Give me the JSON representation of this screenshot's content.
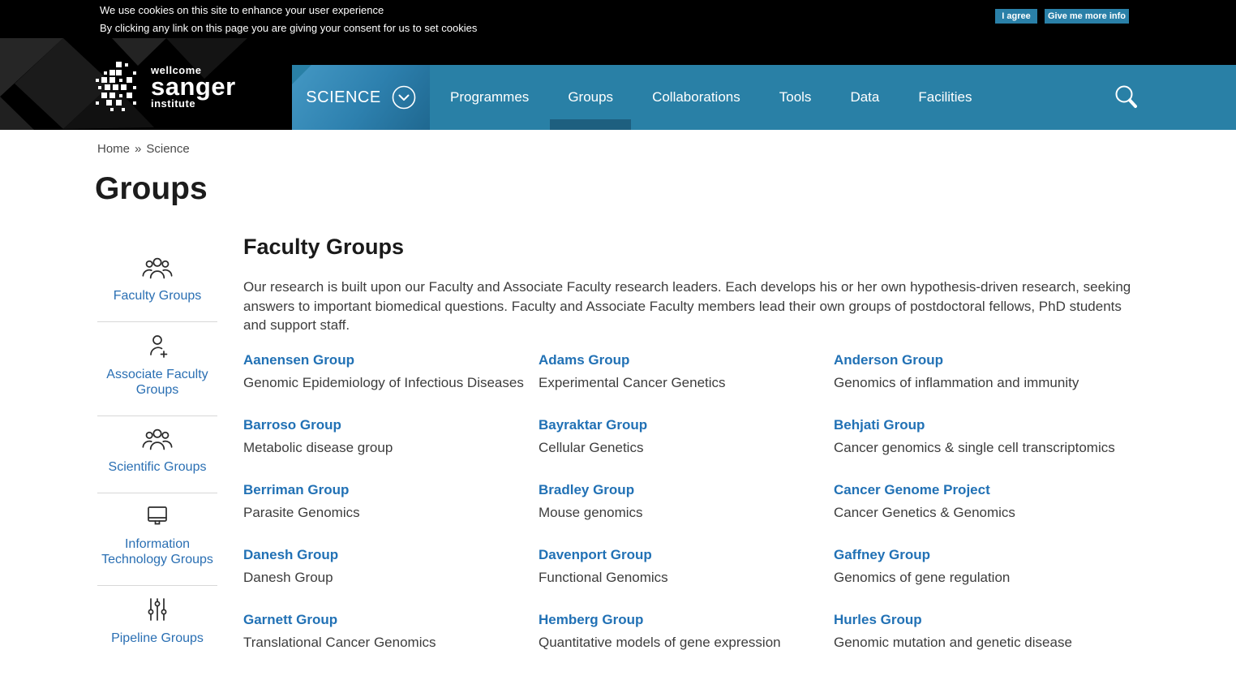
{
  "cookie_banner": {
    "line1": "We use cookies on this site to enhance your user experience",
    "line2": "By clicking any link on this page you are giving your consent for us to set cookies",
    "agree_button": "I agree",
    "info_button": "Give me more info"
  },
  "header": {
    "logo": {
      "wellcome": "wellcome",
      "name": "sanger",
      "institute": "institute"
    },
    "section_button": "SCIENCE",
    "nav_items": [
      {
        "label": "Programmes",
        "active": false
      },
      {
        "label": "Groups",
        "active": true
      },
      {
        "label": "Collaborations",
        "active": false
      },
      {
        "label": "Tools",
        "active": false
      },
      {
        "label": "Data",
        "active": false
      },
      {
        "label": "Facilities",
        "active": false
      }
    ]
  },
  "breadcrumb": {
    "home": "Home",
    "separator": "»",
    "current": "Science"
  },
  "page_title": "Groups",
  "sidebar": {
    "items": [
      {
        "label": "Faculty Groups",
        "icon": "people-group-icon"
      },
      {
        "label": "Associate Faculty Groups",
        "icon": "person-add-icon"
      },
      {
        "label": "Scientific Groups",
        "icon": "people-group-icon"
      },
      {
        "label": "Information Technology Groups",
        "icon": "monitor-icon"
      },
      {
        "label": "Pipeline Groups",
        "icon": "sliders-icon"
      }
    ]
  },
  "main": {
    "heading": "Faculty Groups",
    "intro": "Our research is built upon our Faculty and Associate Faculty research leaders. Each develops his or her own hypothesis-driven research, seeking answers to important biomedical questions. Faculty and Associate Faculty members lead their own groups of postdoctoral fellows, PhD students and support staff.",
    "groups": [
      {
        "name": "Aanensen Group",
        "description": "Genomic Epidemiology of Infectious Diseases"
      },
      {
        "name": "Adams Group",
        "description": "Experimental Cancer Genetics"
      },
      {
        "name": "Anderson Group",
        "description": "Genomics of inflammation and immunity"
      },
      {
        "name": "Barroso Group",
        "description": "Metabolic disease group"
      },
      {
        "name": "Bayraktar Group",
        "description": "Cellular Genetics"
      },
      {
        "name": "Behjati Group",
        "description": "Cancer genomics & single cell transcriptomics"
      },
      {
        "name": "Berriman Group",
        "description": "Parasite Genomics"
      },
      {
        "name": "Bradley Group",
        "description": "Mouse genomics"
      },
      {
        "name": "Cancer Genome Project",
        "description": "Cancer Genetics & Genomics"
      },
      {
        "name": "Danesh Group",
        "description": "Danesh Group"
      },
      {
        "name": "Davenport Group",
        "description": "Functional Genomics"
      },
      {
        "name": "Gaffney Group",
        "description": "Genomics of gene regulation"
      },
      {
        "name": "Garnett Group",
        "description": "Translational Cancer Genomics"
      },
      {
        "name": "Hemberg Group",
        "description": "Quantitative models of gene expression"
      },
      {
        "name": "Hurles Group",
        "description": "Genomic mutation and genetic disease"
      }
    ]
  },
  "colors": {
    "nav_blue": "#2980a6",
    "active_indicator": "#1e5f7f",
    "link_blue": "#2171b5",
    "cookie_button_blue": "#2a80a8"
  }
}
